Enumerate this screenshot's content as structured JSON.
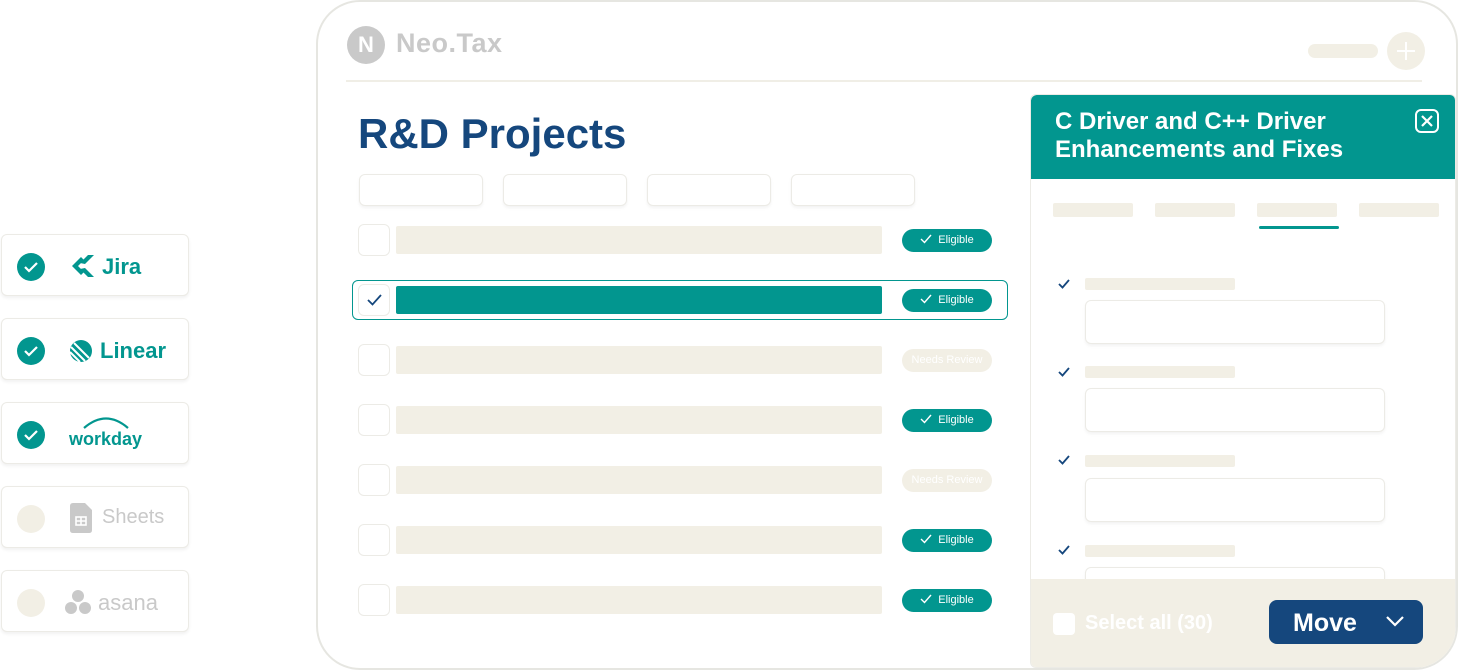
{
  "integrations": [
    {
      "name": "Jira",
      "connected": true,
      "icon": "jira-logo-icon"
    },
    {
      "name": "Linear",
      "connected": true,
      "icon": "linear-logo-icon"
    },
    {
      "name": "workday",
      "connected": true,
      "icon": "workday-logo-icon"
    },
    {
      "name": "Sheets",
      "connected": false,
      "icon": "sheets-logo-icon"
    },
    {
      "name": "asana",
      "connected": false,
      "icon": "asana-logo-icon"
    }
  ],
  "app": {
    "brand_initial": "N",
    "brand_name": "Neo.Tax",
    "page_title": "R&D Projects"
  },
  "projects": [
    {
      "status": "Eligible",
      "selected": false
    },
    {
      "status": "Eligible",
      "selected": true
    },
    {
      "status": "Needs Review",
      "selected": false
    },
    {
      "status": "Eligible",
      "selected": false
    },
    {
      "status": "Needs Review",
      "selected": false
    },
    {
      "status": "Eligible",
      "selected": false
    },
    {
      "status": "Eligible",
      "selected": false
    }
  ],
  "panel": {
    "title": "C Driver and C++ Driver Enhancements and Fixes",
    "active_tab_index": 2,
    "select_all_label": "Select all (30)",
    "move_label": "Move"
  },
  "colors": {
    "accent": "#02968f",
    "navy": "#15477d",
    "placeholder": "#f2efe5",
    "muted": "#c9c9c9"
  }
}
